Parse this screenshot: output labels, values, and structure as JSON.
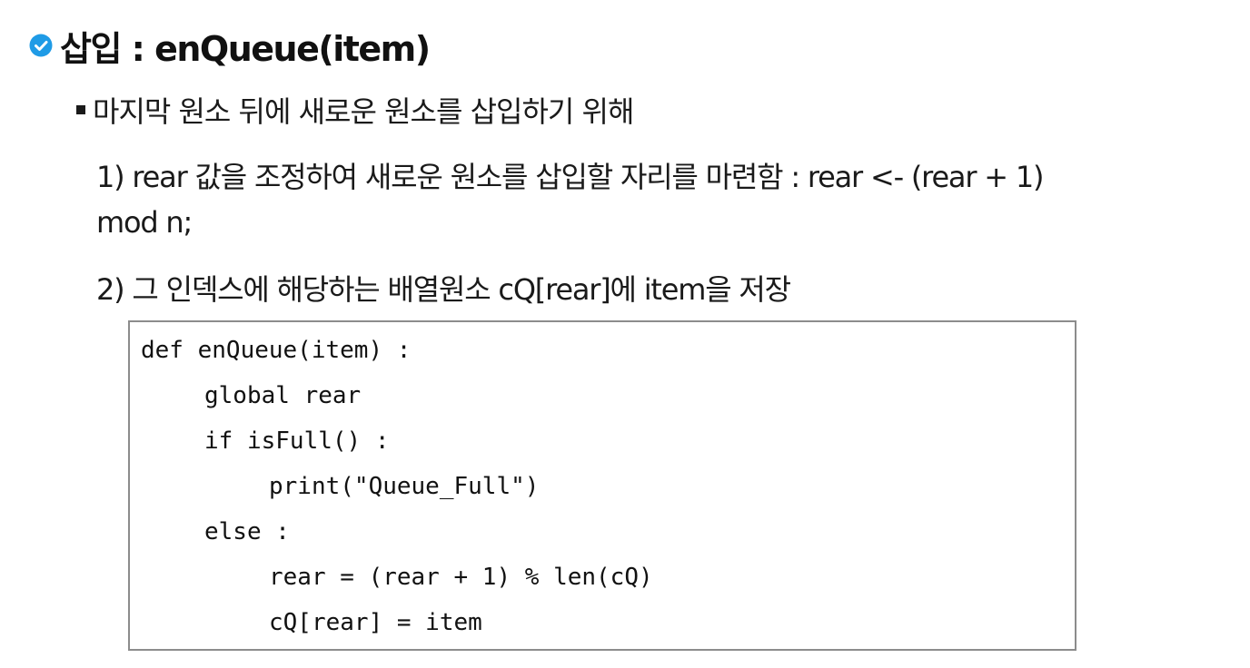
{
  "title": "삽입 : enQueue(item)",
  "bullet": "마지막 원소 뒤에 새로운 원소를 삽입하기 위해",
  "steps": {
    "step1_line1": "1)  rear 값을 조정하여 새로운 원소를 삽입할 자리를 마련함 : rear <- (rear + 1)",
    "step1_line2": "mod n;",
    "step2": "2) 그 인덱스에 해당하는 배열원소 cQ[rear]에 item을 저장"
  },
  "code": [
    "def enQueue(item) :",
    "global rear",
    "if isFull() :",
    "print(\"Queue_Full\")",
    "else :",
    "rear = (rear + 1) % len(cQ)",
    "cQ[rear] = item"
  ],
  "icons": {
    "title_icon": "check-circle-icon",
    "bullet_icon": "square-bullet-icon"
  },
  "colors": {
    "accent": "#1f9be6",
    "text": "#1a1a1a",
    "code_border": "#8c8c8c"
  }
}
